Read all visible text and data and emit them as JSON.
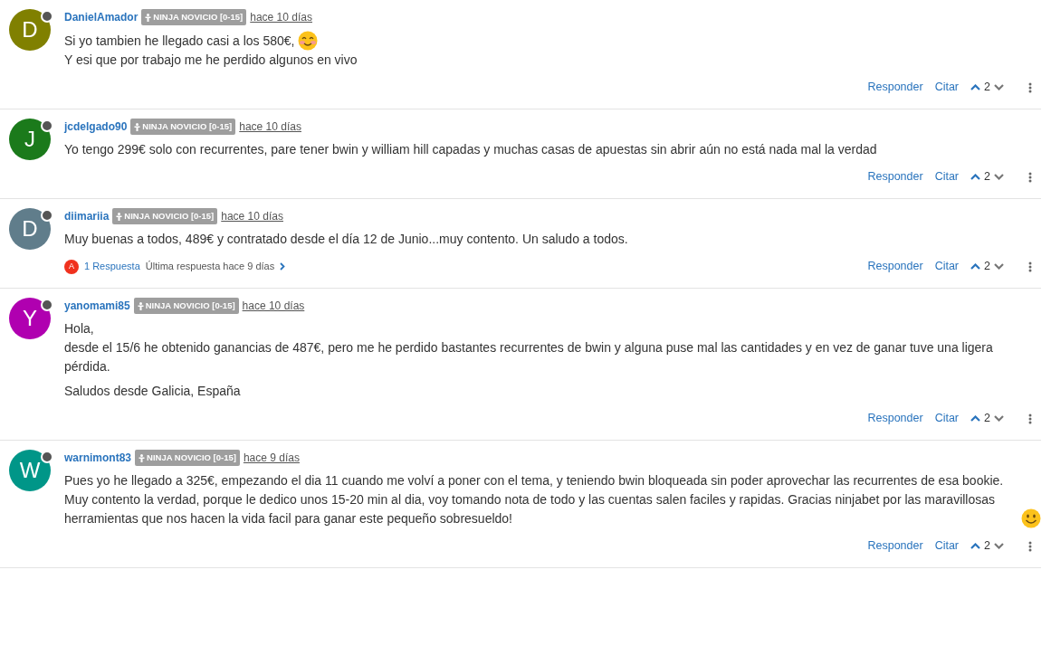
{
  "posts": [
    {
      "avatar": {
        "letter": "D",
        "color": "#808000",
        "online": false
      },
      "username": "DanielAmador",
      "badge": "NINJA NOVICIO [0-15]",
      "time": "hace 10 días",
      "paragraphs": [
        {
          "lines": [
            {
              "kind": "blush",
              "text": "Si yo tambien he llegado casi a los 580€,"
            },
            {
              "kind": "plain",
              "text": "Y esi que por trabajo me he perdido algunos en vivo"
            }
          ]
        }
      ],
      "actions": {
        "reply": "Responder",
        "quote": "Citar",
        "votes": "2"
      }
    },
    {
      "avatar": {
        "letter": "J",
        "color": "#1b7a1b",
        "online": false
      },
      "username": "jcdelgado90",
      "badge": "NINJA NOVICIO [0-15]",
      "time": "hace 10 días",
      "paragraphs": [
        {
          "lines": [
            {
              "kind": "plain",
              "text": "Yo tengo 299€ solo con recurrentes, pare tener bwin y william hill capadas y muchas casas de apuestas sin abrir aún no está nada mal la verdad"
            }
          ]
        }
      ],
      "actions": {
        "reply": "Responder",
        "quote": "Citar",
        "votes": "2"
      }
    },
    {
      "avatar": {
        "letter": "D",
        "color": "#607d8b",
        "online": false
      },
      "username": "diimariia",
      "badge": "NINJA NOVICIO [0-15]",
      "time": "hace 10 días",
      "paragraphs": [
        {
          "lines": [
            {
              "kind": "plain",
              "text": "Muy buenas a todos, 489€ y contratado desde el día 12 de Junio...muy contento. Un saludo a todos."
            }
          ]
        }
      ],
      "replies": {
        "letter": "A",
        "color": "#f0311e",
        "count": "1 Respuesta",
        "last": "Última respuesta hace 9 días"
      },
      "actions": {
        "reply": "Responder",
        "quote": "Citar",
        "votes": "2"
      }
    },
    {
      "avatar": {
        "letter": "Y",
        "color": "#b000b0",
        "online": false
      },
      "username": "yanomami85",
      "badge": "NINJA NOVICIO [0-15]",
      "time": "hace 10 días",
      "paragraphs": [
        {
          "lines": [
            {
              "kind": "plain",
              "text": "Hola,"
            },
            {
              "kind": "plain",
              "text": "desde el 15/6 he obtenido ganancias de 487€, pero me he perdido bastantes recurrentes de bwin y alguna puse mal las cantidades y en vez de ganar tuve una ligera pérdida."
            }
          ]
        },
        {
          "lines": [
            {
              "kind": "plain",
              "text": "Saludos desde Galicia, España"
            }
          ]
        }
      ],
      "actions": {
        "reply": "Responder",
        "quote": "Citar",
        "votes": "2"
      }
    },
    {
      "avatar": {
        "letter": "W",
        "color": "#009688",
        "online": false
      },
      "username": "warnimont83",
      "badge": "NINJA NOVICIO [0-15]",
      "time": "hace 9 días",
      "paragraphs": [
        {
          "lines": [
            {
              "kind": "smile",
              "text": "Pues yo he llegado a 325€, empezando el dia 11 cuando me volví a poner con el tema, y teniendo bwin bloqueada sin poder aprovechar las recurrentes de esa bookie. Muy contento la verdad, porque le dedico unos 15-20 min al dia, voy tomando nota de todo y las cuentas salen faciles y rapidas. Gracias ninjabet por las maravillosas herramientas que nos hacen la vida facil para ganar este pequeño sobresueldo!"
            }
          ]
        }
      ],
      "actions": {
        "reply": "Responder",
        "quote": "Citar",
        "votes": "2"
      }
    }
  ]
}
